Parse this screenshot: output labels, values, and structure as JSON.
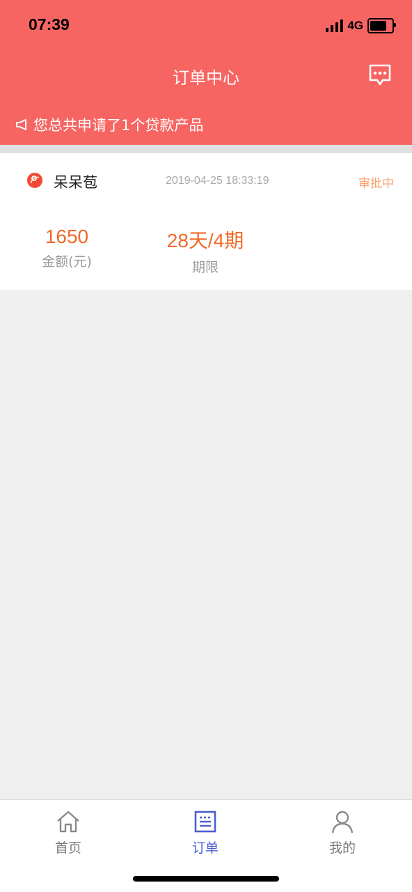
{
  "status_bar": {
    "time": "07:39",
    "network": "4G"
  },
  "header": {
    "title": "订单中心",
    "notice": "您总共申请了1个贷款产品"
  },
  "order": {
    "product_name": "呆呆苞",
    "datetime": "2019-04-25 18:33:19",
    "status": "审批中",
    "amount_value": "1650",
    "amount_label": "金额(元)",
    "term_value": "28天/4期",
    "term_label": "期限"
  },
  "tabs": {
    "home": "首页",
    "orders": "订单",
    "mine": "我的"
  },
  "colors": {
    "header_bg": "#f66562",
    "accent_orange": "#f06a28",
    "status_orange": "#f7a36a",
    "tab_active": "#4d5fcf"
  },
  "icons": {
    "message": "chat-bubble-icon",
    "notice": "megaphone-icon",
    "home": "home-icon",
    "orders": "order-list-icon",
    "mine": "user-icon"
  }
}
